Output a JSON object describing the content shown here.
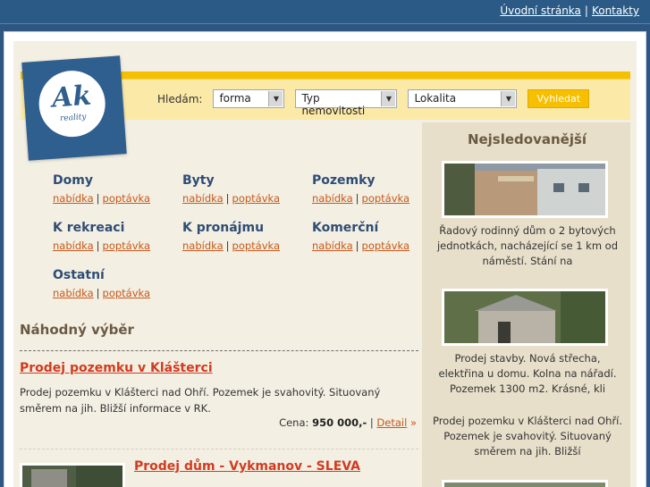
{
  "header": {
    "links": [
      "Úvodní stránka",
      "Kontakty"
    ],
    "separator": "|"
  },
  "logo": {
    "text": "Ak",
    "subtitle": "reality"
  },
  "search": {
    "label": "Hledám:",
    "selects": [
      "forma",
      "Typ nemovitosti",
      "Lokalita"
    ],
    "button": "Vyhledat"
  },
  "categories": [
    {
      "title": "Domy",
      "offer": "nabídka",
      "demand": "poptávka"
    },
    {
      "title": "Byty",
      "offer": "nabídka",
      "demand": "poptávka"
    },
    {
      "title": "Pozemky",
      "offer": "nabídka",
      "demand": "poptávka"
    },
    {
      "title": "K rekreaci",
      "offer": "nabídka",
      "demand": "poptávka"
    },
    {
      "title": "K pronájmu",
      "offer": "nabídka",
      "demand": "poptávka"
    },
    {
      "title": "Komerční",
      "offer": "nabídka",
      "demand": "poptávka"
    },
    {
      "title": "Ostatní",
      "offer": "nabídka",
      "demand": "poptávka"
    }
  ],
  "random": {
    "heading": "Náhodný výběr",
    "item1": {
      "title": "Prodej pozemku v Klášterci",
      "description": "Prodej pozemku v Klášterci nad Ohří. Pozemek je svahovitý. Situovaný směrem na jih. Bližší informace v RK.",
      "price_label": "Cena:",
      "price": "950 000,-",
      "detail": "Detail"
    },
    "item2": {
      "title": "Prodej dům - Vykmanov - SLEVA"
    }
  },
  "sidebar": {
    "title": "Nejsledovanější",
    "items": [
      {
        "text": "Řadový rodinný dům o 2 bytových jednotkách, nacházející se 1 km od náměstí. Stání na"
      },
      {
        "text": "Prodej stavby. Nová střecha, elektřina u domu. Kolna na nářadí. Pozemek 1300 m2. Krásné, kli"
      },
      {
        "text": "Prodej pozemku v Klášterci nad Ohří. Pozemek je svahovitý. Situovaný směrem na jih. Bližší"
      }
    ]
  }
}
